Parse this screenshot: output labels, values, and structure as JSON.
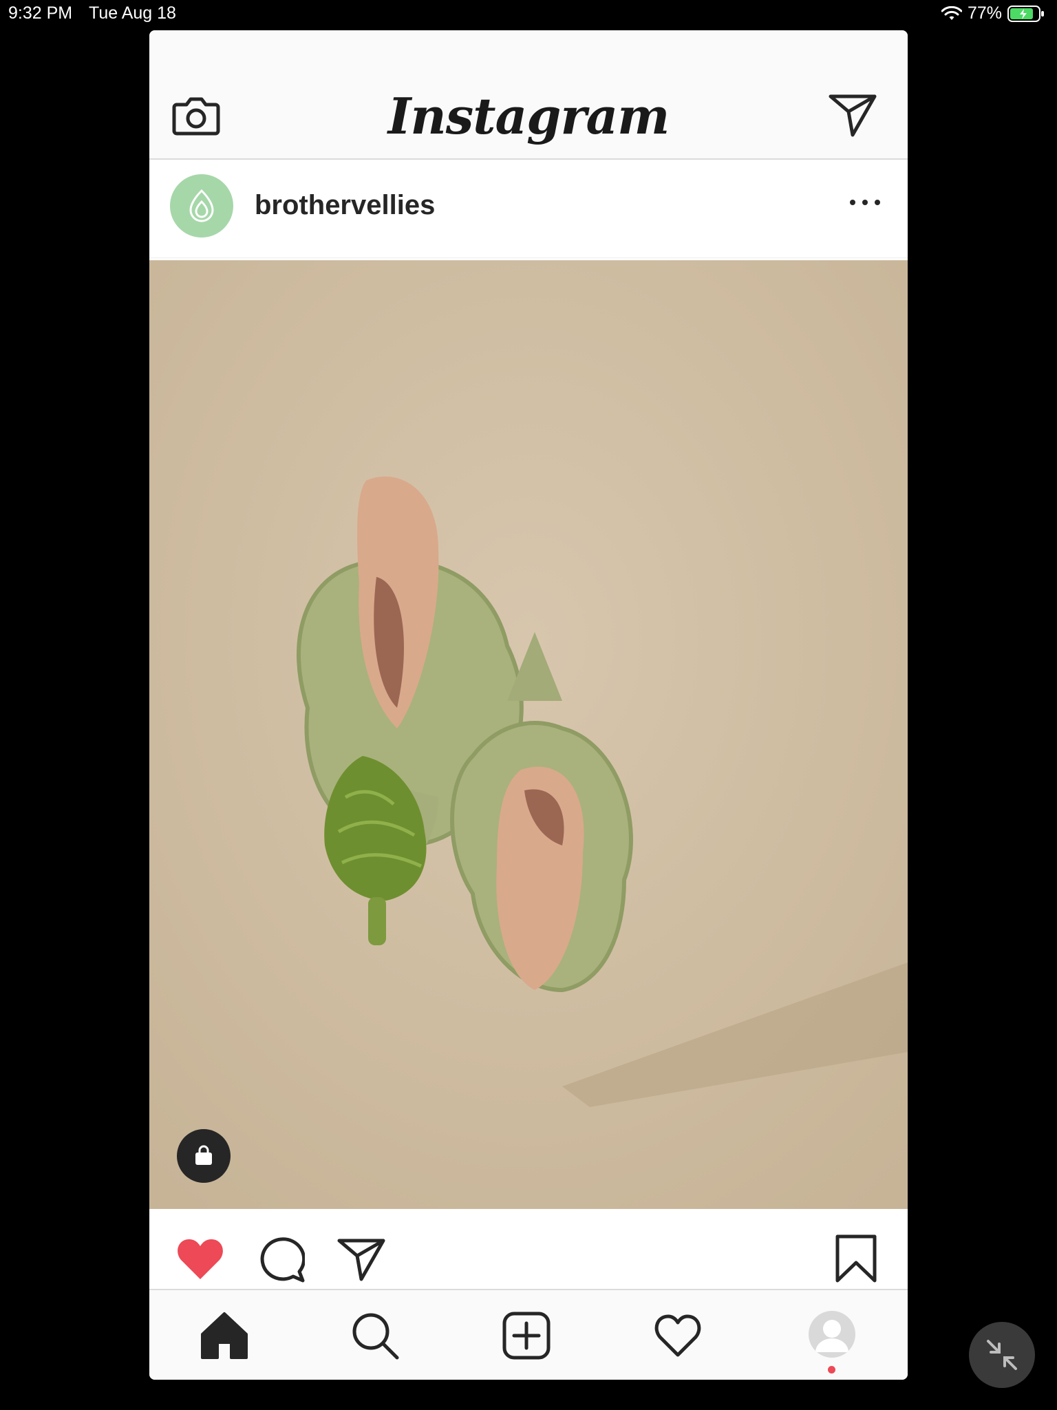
{
  "status_bar": {
    "time": "9:32 PM",
    "date": "Tue Aug 18",
    "battery": "77%"
  },
  "header": {
    "logo": "Instagram",
    "left_icon": "camera-icon",
    "right_icon": "direct-message-icon"
  },
  "post": {
    "username": "brothervellies",
    "avatar_color": "#a6d7a9",
    "liked": true,
    "like_color": "#ed4956",
    "shopping_tag": "shopping-bag-icon"
  },
  "actions": [
    "heart-icon",
    "comment-icon",
    "share-icon",
    "bookmark-icon"
  ],
  "tabbar": [
    "home-icon",
    "search-icon",
    "add-post-icon",
    "activity-heart-icon",
    "profile-icon"
  ],
  "colors": {
    "background": "#000000",
    "image_backdrop": "#cfbea4",
    "shoe_green": "#a6b177",
    "artichoke": "#6e8f2f"
  }
}
